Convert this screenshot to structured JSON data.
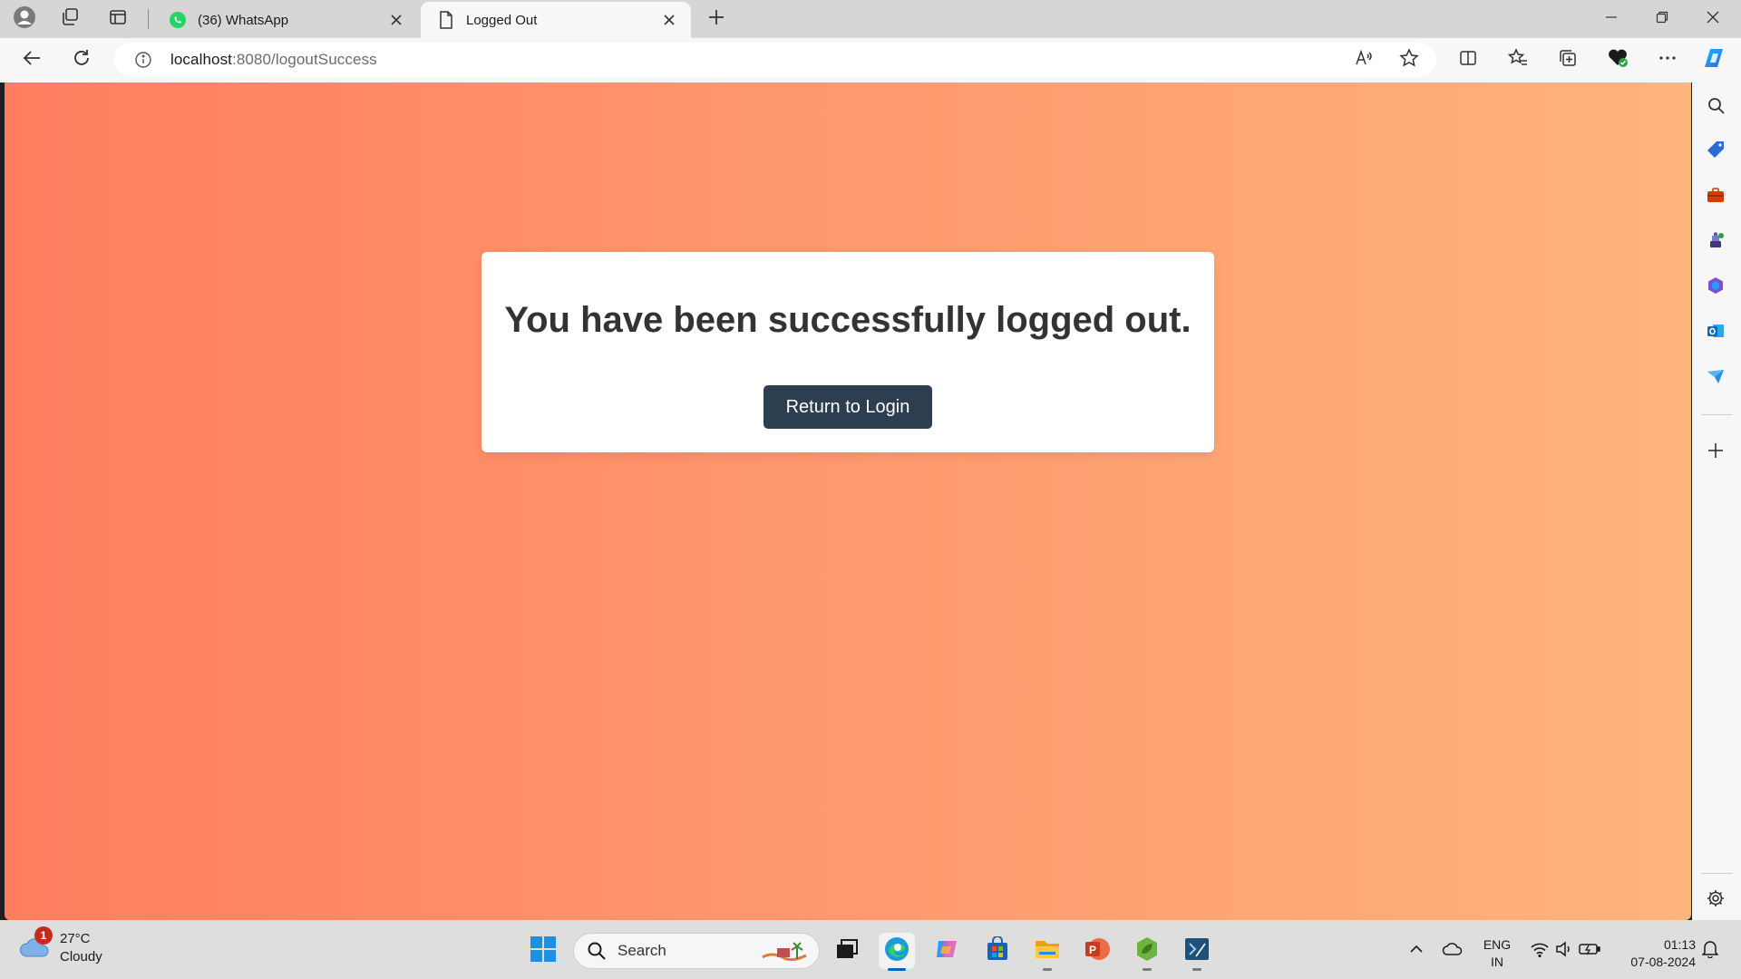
{
  "browser": {
    "tabs": [
      {
        "title": "(36) WhatsApp",
        "icon": "whatsapp-icon",
        "active": false
      },
      {
        "title": "Logged Out",
        "icon": "page-icon",
        "active": true
      }
    ],
    "address": {
      "host": "localhost",
      "rest": ":8080/logoutSuccess"
    }
  },
  "page": {
    "message": "You have been successfully logged out.",
    "button_label": "Return to Login",
    "gradient": [
      "#ff7e5f",
      "#feb47b"
    ],
    "button_color": "#2c3e50"
  },
  "taskbar": {
    "weather": {
      "temp": "27°C",
      "condition": "Cloudy",
      "badge": "1"
    },
    "search_label": "Search",
    "language": {
      "line1": "ENG",
      "line2": "IN"
    },
    "clock": {
      "time": "01:13",
      "date": "07-08-2024"
    }
  },
  "icons": {
    "sidebar": [
      "search-icon",
      "tag-icon",
      "toolbox-icon",
      "games-icon",
      "office-icon",
      "outlook-icon",
      "send-icon",
      "add-icon",
      "settings-icon"
    ],
    "taskbar": [
      "windows-start-icon",
      "task-view-icon",
      "edge-icon",
      "copilot-icon",
      "store-icon",
      "file-explorer-icon",
      "powerpoint-icon",
      "spring-icon",
      "terminal-icon"
    ]
  }
}
